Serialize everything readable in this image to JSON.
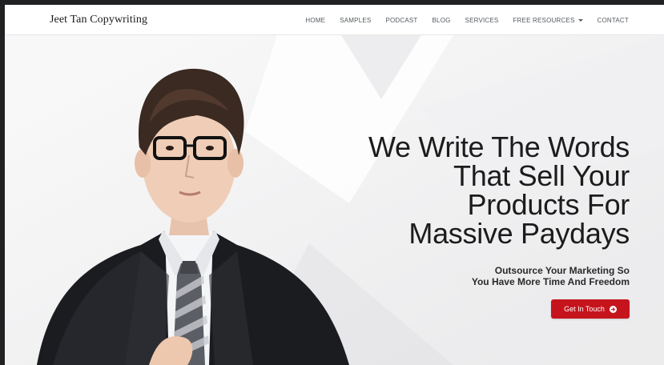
{
  "header": {
    "brand": "Jeet Tan Copywriting",
    "nav": [
      {
        "label": "HOME"
      },
      {
        "label": "SAMPLES"
      },
      {
        "label": "PODCAST"
      },
      {
        "label": "BLOG"
      },
      {
        "label": "SERVICES"
      },
      {
        "label": "FREE RESOURCES",
        "has_dropdown": true
      },
      {
        "label": "CONTACT"
      }
    ]
  },
  "hero": {
    "headline_lines": [
      "We Write The Words",
      "That Sell Your",
      "Products For",
      "Massive Paydays"
    ],
    "subheadline_lines": [
      "Outsource Your Marketing So",
      "You Have More Time And Freedom"
    ],
    "cta_label": "Get In Touch",
    "cta_icon": "arrow-circle-right-icon"
  },
  "colors": {
    "accent": "#c6141d",
    "header_bg": "#ffffff",
    "hero_bg": "#f3f3f4",
    "text_dark": "#1c1c1c"
  }
}
